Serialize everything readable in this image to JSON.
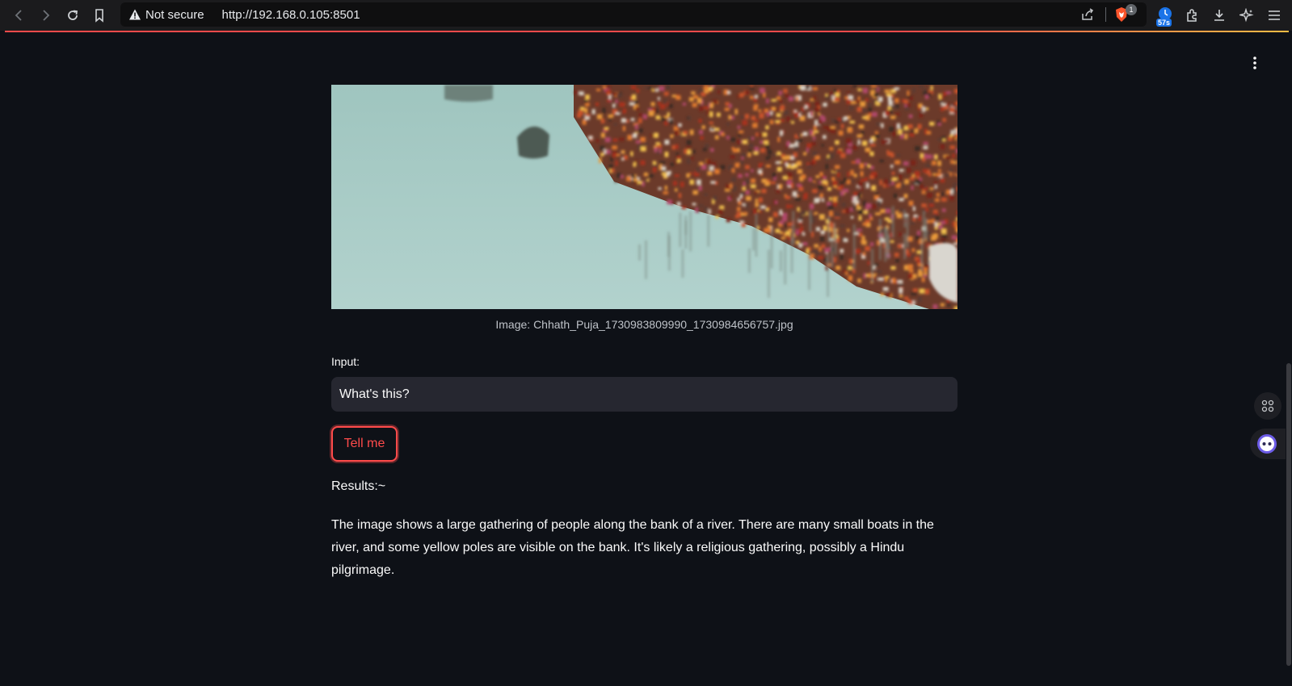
{
  "browser": {
    "security_label": "Not secure",
    "url": "http://192.168.0.105:8501",
    "brave_badge_count": "1",
    "extension_badge": "57s"
  },
  "app": {
    "image_caption": "Image: Chhath_Puja_1730983809990_1730984656757.jpg",
    "input_label": "Input:",
    "input_value": "What's this?",
    "button_label": "Tell me",
    "results_label": "Results:~",
    "result_text": "The image shows a large gathering of people along the bank of a river. There are many small boats in the river, and some yellow poles are visible on the bank. It's likely a religious gathering, possibly a Hindu pilgrimage."
  },
  "colors": {
    "background": "#0e1117",
    "accent": "#ff4b4b",
    "input_bg": "#262730"
  }
}
